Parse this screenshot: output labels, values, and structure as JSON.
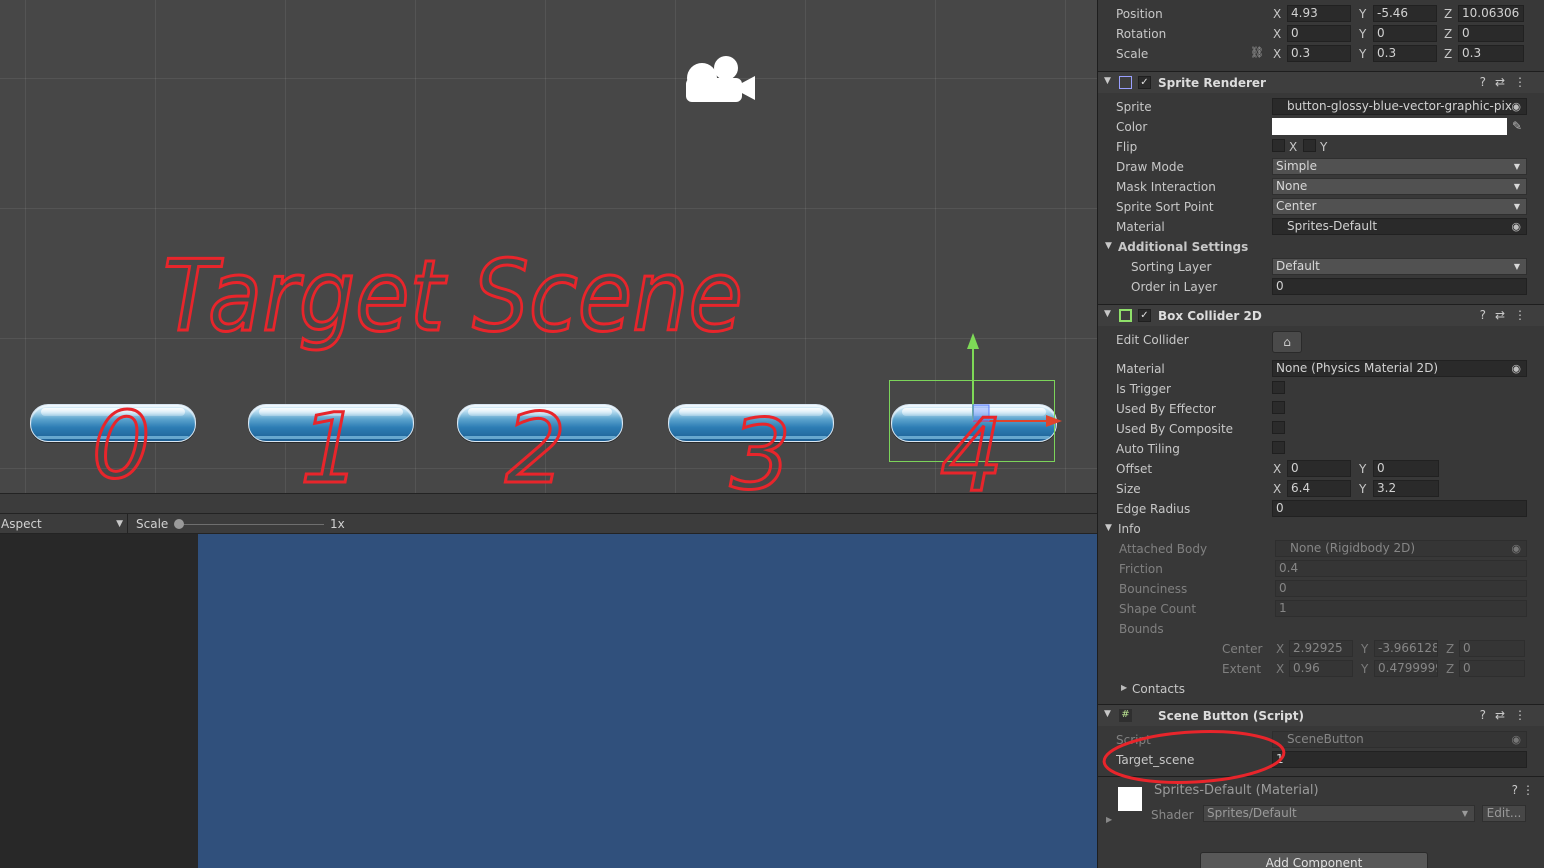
{
  "scene": {
    "annotation_title": "Target Scene",
    "button_digits": [
      "0",
      "1",
      "2",
      "3",
      "4"
    ],
    "annotation_color": "#e8252b"
  },
  "game_toolbar": {
    "aspect": "Aspect",
    "scale_label": "Scale",
    "scale_value": "1x"
  },
  "inspector": {
    "transform": {
      "position_label": "Position",
      "position": {
        "x": "4.93",
        "y": "-5.46",
        "z": "10.06306"
      },
      "rotation_label": "Rotation",
      "rotation": {
        "x": "0",
        "y": "0",
        "z": "0"
      },
      "scale_label": "Scale",
      "scale": {
        "x": "0.3",
        "y": "0.3",
        "z": "0.3"
      },
      "axis": {
        "x": "X",
        "y": "Y",
        "z": "Z"
      }
    },
    "sprite_renderer": {
      "title": "Sprite Renderer",
      "sprite_label": "Sprite",
      "sprite": "button-glossy-blue-vector-graphic-pix",
      "color_label": "Color",
      "flip_label": "Flip",
      "flip_x": "X",
      "flip_y": "Y",
      "draw_mode_label": "Draw Mode",
      "draw_mode": "Simple",
      "mask_label": "Mask Interaction",
      "mask": "None",
      "sort_point_label": "Sprite Sort Point",
      "sort_point": "Center",
      "material_label": "Material",
      "material": "Sprites-Default",
      "additional_label": "Additional Settings",
      "sorting_layer_label": "Sorting Layer",
      "sorting_layer": "Default",
      "order_label": "Order in Layer",
      "order": "0"
    },
    "box_collider": {
      "title": "Box Collider 2D",
      "edit_label": "Edit Collider",
      "material_label": "Material",
      "material": "None (Physics Material 2D)",
      "is_trigger_label": "Is Trigger",
      "effector_label": "Used By Effector",
      "composite_label": "Used By Composite",
      "auto_tiling_label": "Auto Tiling",
      "offset_label": "Offset",
      "offset": {
        "x": "0",
        "y": "0"
      },
      "size_label": "Size",
      "size": {
        "x": "6.4",
        "y": "3.2"
      },
      "edge_label": "Edge Radius",
      "edge": "0",
      "info_label": "Info",
      "attached_label": "Attached Body",
      "attached": "None (Rigidbody 2D)",
      "friction_label": "Friction",
      "friction": "0.4",
      "bounciness_label": "Bounciness",
      "bounciness": "0",
      "shape_count_label": "Shape Count",
      "shape_count": "1",
      "bounds_label": "Bounds",
      "center_label": "Center",
      "center": {
        "x": "2.92925",
        "y": "-3.966128",
        "z": "0"
      },
      "extent_label": "Extent",
      "extent": {
        "x": "0.96",
        "y": "0.4799999",
        "z": "0"
      },
      "contacts_label": "Contacts"
    },
    "scene_button": {
      "title": "Scene Button (Script)",
      "script_label": "Script",
      "script": "SceneButton",
      "target_label": "Target_scene",
      "target": "1"
    },
    "material": {
      "title": "Sprites-Default (Material)",
      "shader_label": "Shader",
      "shader": "Sprites/Default",
      "edit_label": "Edit..."
    },
    "add_component": "Add Component"
  }
}
